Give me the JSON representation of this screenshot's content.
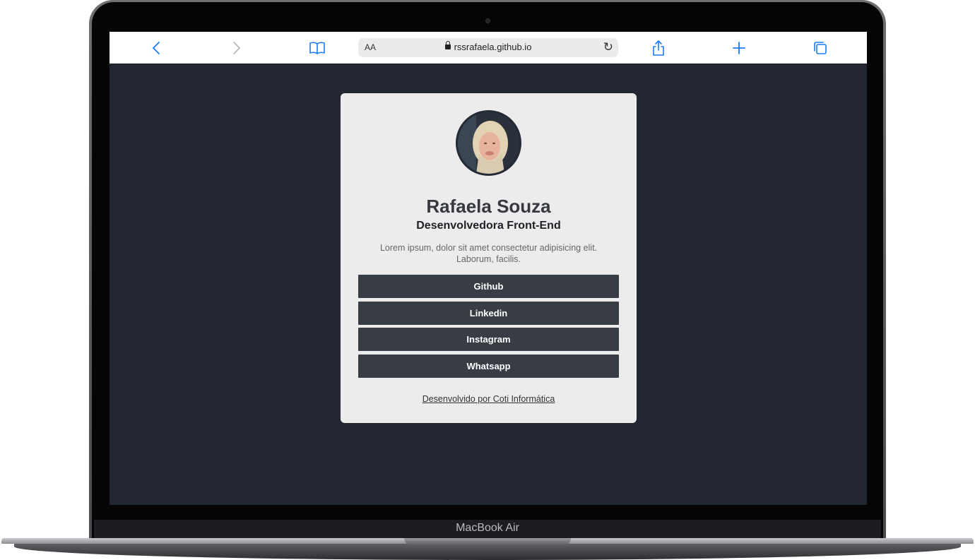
{
  "browser": {
    "text_size_label": "AA",
    "url": "rssrafaela.github.io",
    "accent": "#1a7cf5"
  },
  "profile": {
    "name": "Rafaela Souza",
    "role": "Desenvolvedora Front-End",
    "bio": "Lorem ipsum, dolor sit amet consectetur adipisicing elit. Laborum, facilis.",
    "links": [
      {
        "label": "Github"
      },
      {
        "label": "Linkedin"
      },
      {
        "label": "Instagram"
      },
      {
        "label": "Whatsapp"
      }
    ],
    "footer": "Desenvolvido por Coti Informática"
  },
  "device": {
    "label": "MacBook Air"
  },
  "colors": {
    "page_background": "#222630",
    "card_background": "#ececec",
    "button_background": "#383c45"
  }
}
